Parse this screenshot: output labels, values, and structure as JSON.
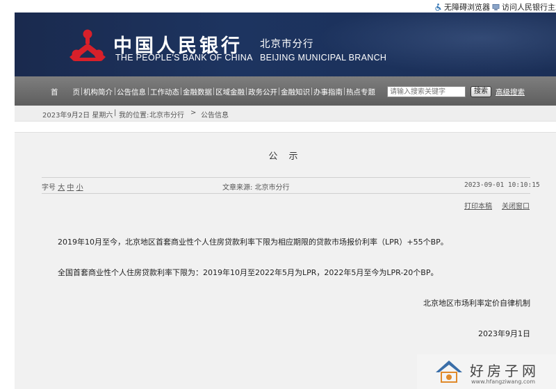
{
  "topbar": {
    "accessibility_label": "无障碍浏览器",
    "visit_label": "访问人民银行主站"
  },
  "banner": {
    "title_cn": "中国人民银行",
    "title_en": "THE PEOPLE'S BANK OF CHINA",
    "branch_cn": "北京市分行",
    "branch_en": "BEIJING MUNICIPAL BRANCH"
  },
  "nav": {
    "items": [
      "首　　页",
      "机构简介",
      "公告信息",
      "工作动态",
      "金融数据",
      "区域金融",
      "政务公开",
      "金融知识",
      "办事指南",
      "热点专题"
    ],
    "search_placeholder": "请输入搜索关键字",
    "search_button": "搜索",
    "advanced_search": "高级搜索"
  },
  "breadcrumb": {
    "date": "2023年9月2日  星期六",
    "location_prefix": "我的位置:",
    "level1": "北京市分行",
    "arrow": ">",
    "level2": "公告信息"
  },
  "article": {
    "title": "公 示",
    "font_size_label": "字号",
    "font_large": "大",
    "font_medium": "中",
    "font_small": "小",
    "source": "文章来源: 北京市分行",
    "timestamp": "2023-09-01  10:10:15",
    "print_link": "打印本稿",
    "close_link": "关闭窗口",
    "paragraph1": "2019年10月至今，北京地区首套商业性个人住房贷款利率下限为相应期限的贷款市场报价利率（LPR）+55个BP。",
    "paragraph2": "全国首套商业性个人住房贷款利率下限为：2019年10月至2022年5月为LPR，2022年5月至今为LPR-20个BP。",
    "signature": "北京地区市场利率定价自律机制",
    "date": "2023年9月1日"
  },
  "watermark": {
    "text": "好房子网",
    "url": "www.hfangziwang.com"
  },
  "colors": {
    "banner_bg": "#1b2f57",
    "nav_bg": "#6e6e6e",
    "logo_red": "#d8202a",
    "article_bg": "#f1f1f1"
  }
}
